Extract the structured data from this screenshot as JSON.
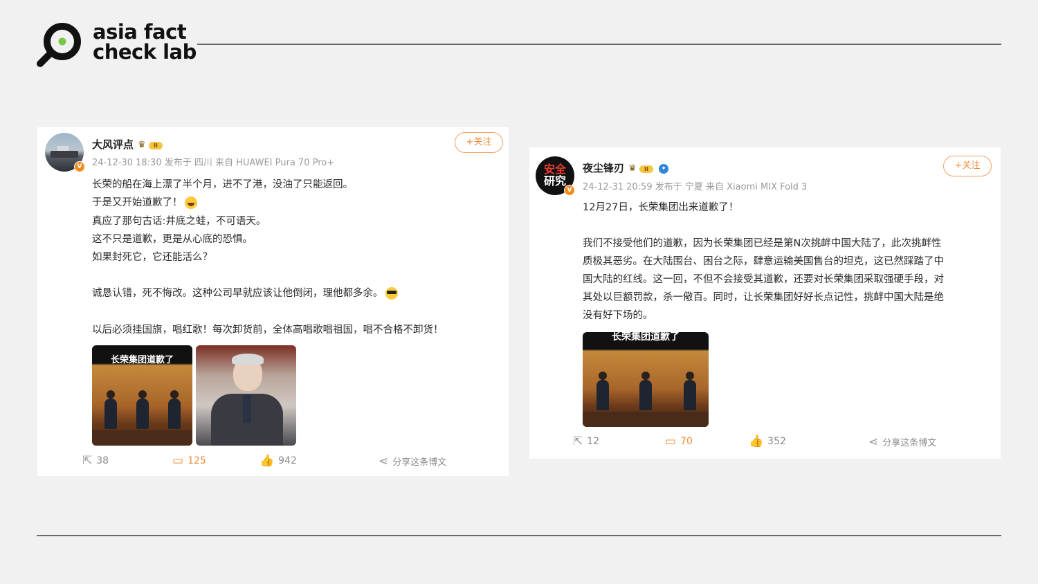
{
  "header": {
    "logo_line1": "asia fact",
    "logo_line2": "check lab",
    "brand_colors": {
      "ring": "#111111",
      "dot": "#7ac943"
    }
  },
  "posts": [
    {
      "username": "大风评点",
      "level_badge": "II",
      "verified_badge": "V",
      "meta": "24-12-30 18:30 发布于 四川 来自 HUAWEI Pura 70 Pro+",
      "follow_label": "+关注",
      "lines": [
        "长荣的船在海上漂了半个月，进不了港，没油了只能返回。",
        "于是又开始道歉了！",
        "真应了那句古话:井底之蛙，不可语天。",
        "这不只是道歉，更是从心底的恐惧。",
        "如果封死它，它还能活么？",
        "",
        "诚恳认错，死不悔改。这种公司早就应该让他倒闭，理他都多余。",
        "",
        "以后必须挂国旗，唱红歌！每次卸货前，全体高唱歌唱祖国，唱不合格不卸货！"
      ],
      "media": [
        {
          "caption": "长荣集团道歉了",
          "icon": "apology-bow-image"
        },
        {
          "caption": "",
          "icon": "elderly-man-portrait"
        }
      ],
      "actions": {
        "repost_count": "38",
        "comment_count": "125",
        "like_count": "942",
        "share_label": "分享这条博文"
      }
    },
    {
      "username": "夜尘锋刃",
      "level_badge": "II",
      "verified_badge": "V",
      "avatar_text_line1": "安全",
      "avatar_text_line2": "研究",
      "meta": "24-12-31 20:59 发布于 宁夏 来自 Xiaomi MIX Fold 3",
      "follow_label": "+关注",
      "lines": [
        "12月27日，长荣集团出来道歉了！",
        "",
        "我们不接受他们的道歉，因为长荣集团已经是第N次挑衅中国大陆了，此次挑衅性",
        "质极其恶劣。在大陆围台、困台之际，肆意运输美国售台的坦克，这已然踩踏了中",
        "国大陆的红线。这一回，不但不会接受其道歉，还要对长荣集团采取强硬手段，对",
        "其处以巨额罚款，杀一儆百。同时，让长荣集团好好长点记性，挑衅中国大陆是绝",
        "没有好下场的。"
      ],
      "media": [
        {
          "caption": "长荣集团道歉了",
          "icon": "apology-bow-image"
        }
      ],
      "actions": {
        "repost_count": "12",
        "comment_count": "70",
        "like_count": "352",
        "share_label": "分享这条博文"
      }
    }
  ]
}
